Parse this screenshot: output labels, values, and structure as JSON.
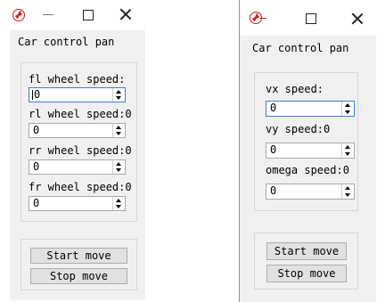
{
  "left_window": {
    "title": "Car control pan",
    "fields": [
      {
        "label": "fl wheel speed:",
        "value": "0"
      },
      {
        "label": "rl wheel speed:0",
        "value": "0"
      },
      {
        "label": "rr wheel speed:0",
        "value": "0"
      },
      {
        "label": "fr wheel speed:0",
        "value": "0"
      }
    ],
    "start_label": "Start move",
    "stop_label": "Stop move"
  },
  "right_window": {
    "title": "Car control pan",
    "fields": [
      {
        "label": "vx speed:",
        "value": "0"
      },
      {
        "label": "vy speed:0",
        "value": "0"
      },
      {
        "label": "omega speed:0",
        "value": "0"
      }
    ],
    "start_label": "Start move",
    "stop_label": "Stop move"
  },
  "colors": {
    "icon_red": "#d41a1a",
    "focus_blue": "#3c7fd8"
  }
}
